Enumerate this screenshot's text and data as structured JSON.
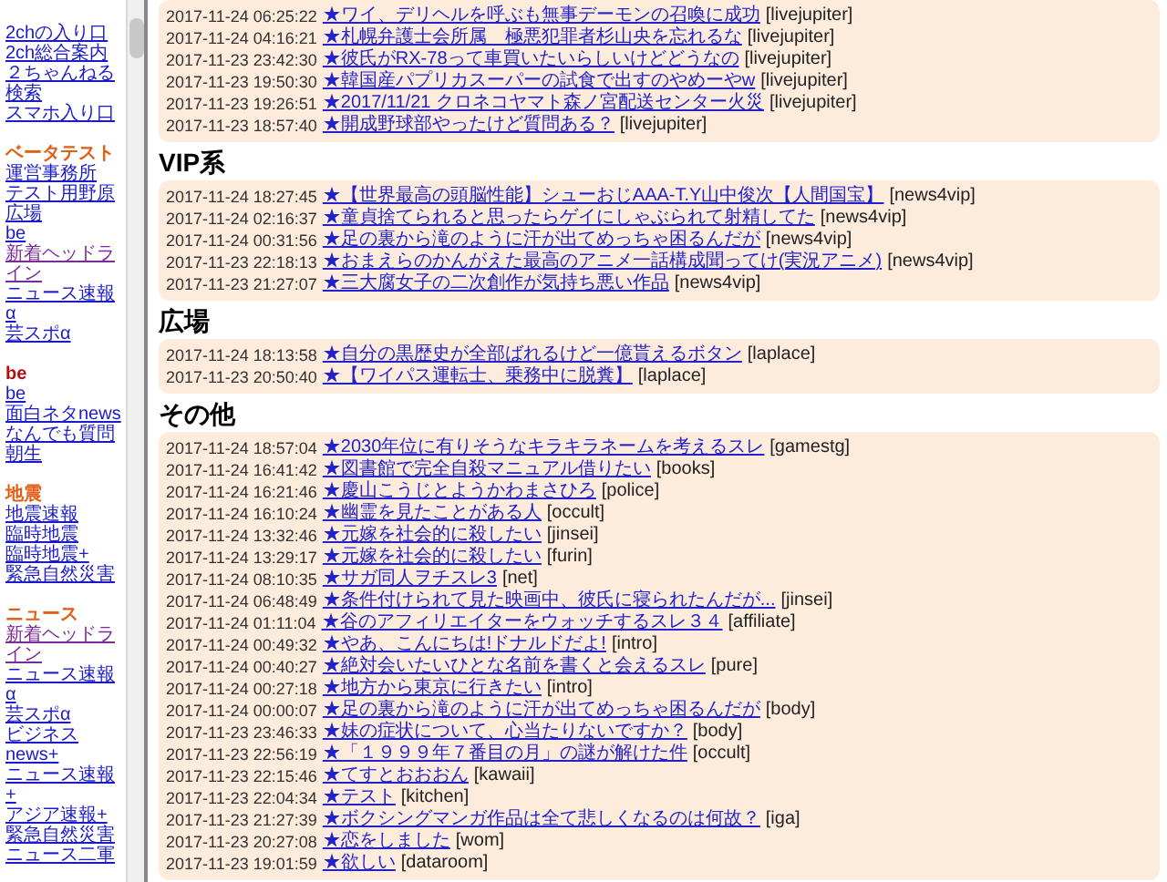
{
  "sidebar": {
    "groups": [
      {
        "links": [
          {
            "label": "2chの入り口",
            "visited": false
          },
          {
            "label": "2ch総合案内",
            "visited": false
          },
          {
            "label": "２ちゃんねる検索",
            "visited": false
          },
          {
            "label": "スマホ入り口",
            "visited": false
          }
        ]
      },
      {
        "heading": "ベータテスト",
        "color": "#e0601a",
        "links": [
          {
            "label": "運営事務所",
            "visited": false
          },
          {
            "label": "テスト用野原",
            "visited": false
          },
          {
            "label": "広場",
            "visited": false
          },
          {
            "label": "be",
            "visited": false
          },
          {
            "label": "新着ヘッドライン",
            "visited": true
          },
          {
            "label": "ニュース速報α",
            "visited": false
          },
          {
            "label": "芸スポα",
            "visited": false
          }
        ]
      },
      {
        "heading": "be",
        "color": "#b01010",
        "links": [
          {
            "label": "be",
            "visited": false
          },
          {
            "label": "面白ネタnews",
            "visited": false
          },
          {
            "label": "なんでも質問",
            "visited": false
          },
          {
            "label": "朝生",
            "visited": false
          }
        ]
      },
      {
        "heading": "地震",
        "color": "#e0601a",
        "links": [
          {
            "label": "地震速報",
            "visited": false
          },
          {
            "label": "臨時地震",
            "visited": false
          },
          {
            "label": "臨時地震+",
            "visited": false
          },
          {
            "label": "緊急自然災害",
            "visited": false
          }
        ]
      },
      {
        "heading": "ニュース",
        "color": "#e0601a",
        "links": [
          {
            "label": "新着ヘッドライン",
            "visited": true
          },
          {
            "label": "ニュース速報α",
            "visited": false
          },
          {
            "label": "芸スポα",
            "visited": false
          },
          {
            "label": "ビジネスnews+",
            "visited": false
          },
          {
            "label": "ニュース速報+",
            "visited": false
          },
          {
            "label": "アジア速報+",
            "visited": false
          },
          {
            "label": "緊急自然災害",
            "visited": false
          },
          {
            "label": "ニュース二軍",
            "visited": false
          }
        ]
      }
    ]
  },
  "sections": [
    {
      "rows": [
        {
          "time": "2017-11-24 06:25:22",
          "title": "★ワイ、デリヘルを呼ぶも無事デーモンの召喚に成功",
          "board": "[livejupiter]"
        },
        {
          "time": "2017-11-24 04:16:21",
          "title": "★札幌弁護士会所属　極悪犯罪者杉山央を忘れるな",
          "board": "[livejupiter]"
        },
        {
          "time": "2017-11-23 23:42:30",
          "title": "★彼氏がRX-78って車買いたいらしいけどどうなの",
          "board": "[livejupiter]"
        },
        {
          "time": "2017-11-23 19:50:30",
          "title": "★韓国産パプリカスーパーの試食で出すのやめーやw",
          "board": "[livejupiter]"
        },
        {
          "time": "2017-11-23 19:26:51",
          "title": "★2017/11/21 クロネコヤマト森ノ宮配送センター火災",
          "board": "[livejupiter]"
        },
        {
          "time": "2017-11-23 18:57:40",
          "title": "★開成野球部やったけど質問ある？",
          "board": "[livejupiter]"
        }
      ]
    },
    {
      "title": "VIP系",
      "rows": [
        {
          "time": "2017-11-24 18:27:45",
          "title": "★【世界最高の頭脳性能】シューおじAAA-T.Y山中俊次【人間国宝】",
          "board": "[news4vip]"
        },
        {
          "time": "2017-11-24 02:16:37",
          "title": "★童貞捨てられると思ったらゲイにしゃぶられて射精してた",
          "board": "[news4vip]"
        },
        {
          "time": "2017-11-24 00:31:56",
          "title": "★足の裏から滝のように汗が出てめっちゃ困るんだが",
          "board": "[news4vip]"
        },
        {
          "time": "2017-11-23 22:18:13",
          "title": "★おまえらのかんがえた最高のアニメ一話構成聞ってけ(実況アニメ)",
          "board": "[news4vip]"
        },
        {
          "time": "2017-11-23 21:27:07",
          "title": "★三大腐女子の二次創作が気持ち悪い作品",
          "board": "[news4vip]"
        }
      ]
    },
    {
      "title": "広場",
      "rows": [
        {
          "time": "2017-11-24 18:13:58",
          "title": "★自分の黒歴史が全部ばれるけど一億貰えるボタン",
          "board": "[laplace]"
        },
        {
          "time": "2017-11-23 20:50:40",
          "title": "★【ワイパス運転士、乗務中に脱糞】",
          "board": "[laplace]"
        }
      ]
    },
    {
      "title": "その他",
      "rows": [
        {
          "time": "2017-11-24 18:57:04",
          "title": "★2030年位に有りそうなキラキラネームを考えるスレ",
          "board": "[gamestg]"
        },
        {
          "time": "2017-11-24 16:41:42",
          "title": "★図書館で完全自殺マニュアル借りたい",
          "board": "[books]"
        },
        {
          "time": "2017-11-24 16:21:46",
          "title": "★慶山こうじとようかわまさひろ",
          "board": "[police]"
        },
        {
          "time": "2017-11-24 16:10:24",
          "title": "★幽霊を見たことがある人",
          "board": "[occult]"
        },
        {
          "time": "2017-11-24 13:32:46",
          "title": "★元嫁を社会的に殺したい",
          "board": "[jinsei]"
        },
        {
          "time": "2017-11-24 13:29:17",
          "title": "★元嫁を社会的に殺したい",
          "board": "[furin]"
        },
        {
          "time": "2017-11-24 08:10:35",
          "title": "★サガ同人ヲチスレ3",
          "board": "[net]"
        },
        {
          "time": "2017-11-24 06:48:49",
          "title": "★条件付けられて見た映画中、彼氏に寝られたんだが...",
          "board": "[jinsei]"
        },
        {
          "time": "2017-11-24 01:11:04",
          "title": "★谷のアフィリエイターをウォッチするスレ３４",
          "board": "[affiliate]"
        },
        {
          "time": "2017-11-24 00:49:32",
          "title": "★やあ、こんにちは!ドナルドだよ!",
          "board": "[intro]"
        },
        {
          "time": "2017-11-24 00:40:27",
          "title": "★絶対会いたいひとな名前を書くと会えるスレ",
          "board": "[pure]"
        },
        {
          "time": "2017-11-24 00:27:18",
          "title": "★地方から東京に行きたい",
          "board": "[intro]"
        },
        {
          "time": "2017-11-24 00:00:07",
          "title": "★足の裏から滝のように汗が出てめっちゃ困るんだが",
          "board": "[body]"
        },
        {
          "time": "2017-11-23 23:46:33",
          "title": "★妹の症状について、心当たりないですか？",
          "board": "[body]"
        },
        {
          "time": "2017-11-23 22:56:19",
          "title": "★「１９９９年７番目の月」の謎が解けた件",
          "board": "[occult]"
        },
        {
          "time": "2017-11-23 22:15:46",
          "title": "★てすとおおおん",
          "board": "[kawaii]"
        },
        {
          "time": "2017-11-23 22:04:34",
          "title": "★テスト",
          "board": "[kitchen]"
        },
        {
          "time": "2017-11-23 21:27:39",
          "title": "★ボクシングマンガ作品は全て悲しくなるのは何故？",
          "board": "[iga]"
        },
        {
          "time": "2017-11-23 20:27:08",
          "title": "★恋をしました",
          "board": "[wom]"
        },
        {
          "time": "2017-11-23 19:01:59",
          "title": "★欲しい",
          "board": "[dataroom]"
        }
      ]
    }
  ]
}
